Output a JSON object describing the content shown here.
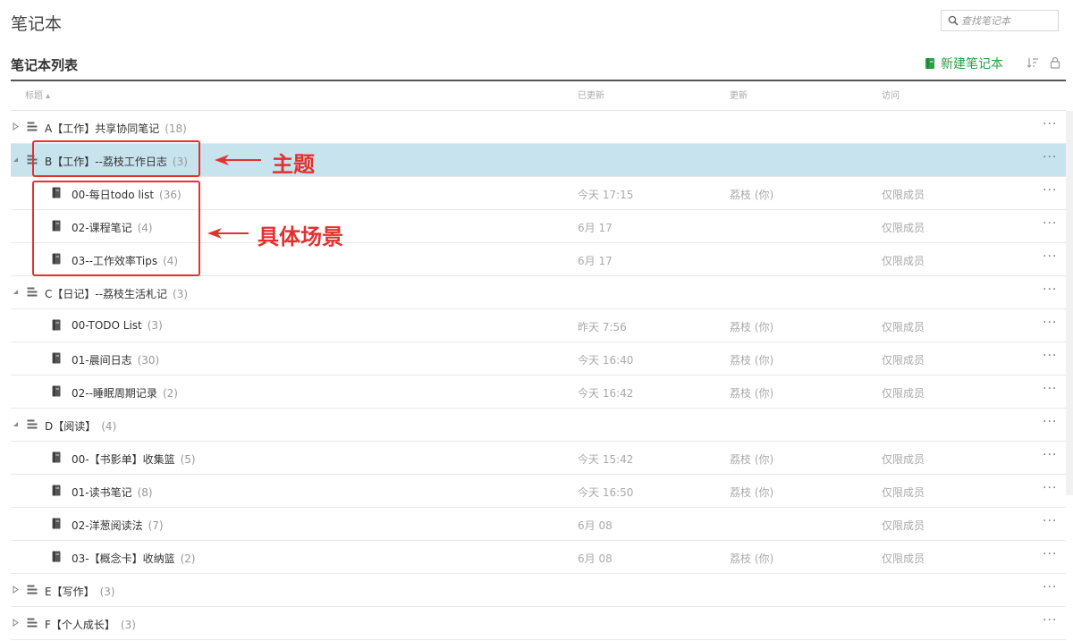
{
  "app": {
    "title": "笔记本"
  },
  "search": {
    "placeholder": "查找笔记本"
  },
  "section": {
    "title": "笔记本列表",
    "new_label": "新建笔记本"
  },
  "columns": {
    "title": "标题 ▴",
    "updated": "已更新",
    "updater": "更新",
    "access": "访问"
  },
  "colors": {
    "accent": "#2ba046",
    "selected_row": "#c7e3ee",
    "annotation": "#e53030"
  },
  "more_label": "···",
  "stacks": [
    {
      "name": "A【工作】共享协同笔记",
      "count": "(18)",
      "expanded": false,
      "notebooks": []
    },
    {
      "name": "B【工作】--荔枝工作日志",
      "count": "(3)",
      "expanded": true,
      "selected": true,
      "notebooks": [
        {
          "name": "00-每日todo list",
          "count": "(36)",
          "updated": "今天 17:15",
          "updater": "荔枝 (你)",
          "access": "仅限成员"
        },
        {
          "name": "02-课程笔记",
          "count": "(4)",
          "updated": "6月 17",
          "updater": "",
          "access": "仅限成员"
        },
        {
          "name": "03--工作效率Tips",
          "count": "(4)",
          "updated": "6月 17",
          "updater": "",
          "access": "仅限成员"
        }
      ]
    },
    {
      "name": "C【日记】--荔枝生活札记",
      "count": "(3)",
      "expanded": true,
      "notebooks": [
        {
          "name": "00-TODO List",
          "count": "(3)",
          "updated": "昨天 7:56",
          "updater": "荔枝 (你)",
          "access": "仅限成员"
        },
        {
          "name": "01-晨间日志",
          "count": "(30)",
          "updated": "今天 16:40",
          "updater": "荔枝 (你)",
          "access": "仅限成员"
        },
        {
          "name": "02--睡眠周期记录",
          "count": "(2)",
          "updated": "今天 16:42",
          "updater": "荔枝 (你)",
          "access": "仅限成员"
        }
      ]
    },
    {
      "name": "D【阅读】",
      "count": "(4)",
      "expanded": true,
      "notebooks": [
        {
          "name": "00-【书影单】收集篮",
          "count": "(5)",
          "updated": "今天 15:42",
          "updater": "荔枝 (你)",
          "access": "仅限成员"
        },
        {
          "name": "01-读书笔记",
          "count": "(8)",
          "updated": "今天 16:50",
          "updater": "荔枝 (你)",
          "access": "仅限成员"
        },
        {
          "name": "02-洋葱阅读法",
          "count": "(7)",
          "updated": "6月 08",
          "updater": "",
          "access": "仅限成员"
        },
        {
          "name": "03-【概念卡】收纳篮",
          "count": "(2)",
          "updated": "6月 08",
          "updater": "荔枝 (你)",
          "access": "仅限成员"
        }
      ]
    },
    {
      "name": "E【写作】",
      "count": "(3)",
      "expanded": false,
      "notebooks": []
    },
    {
      "name": "F【个人成长】",
      "count": "(3)",
      "expanded": false,
      "notebooks": []
    }
  ],
  "annotations": {
    "topic": "主题",
    "scenes": "具体场景"
  }
}
